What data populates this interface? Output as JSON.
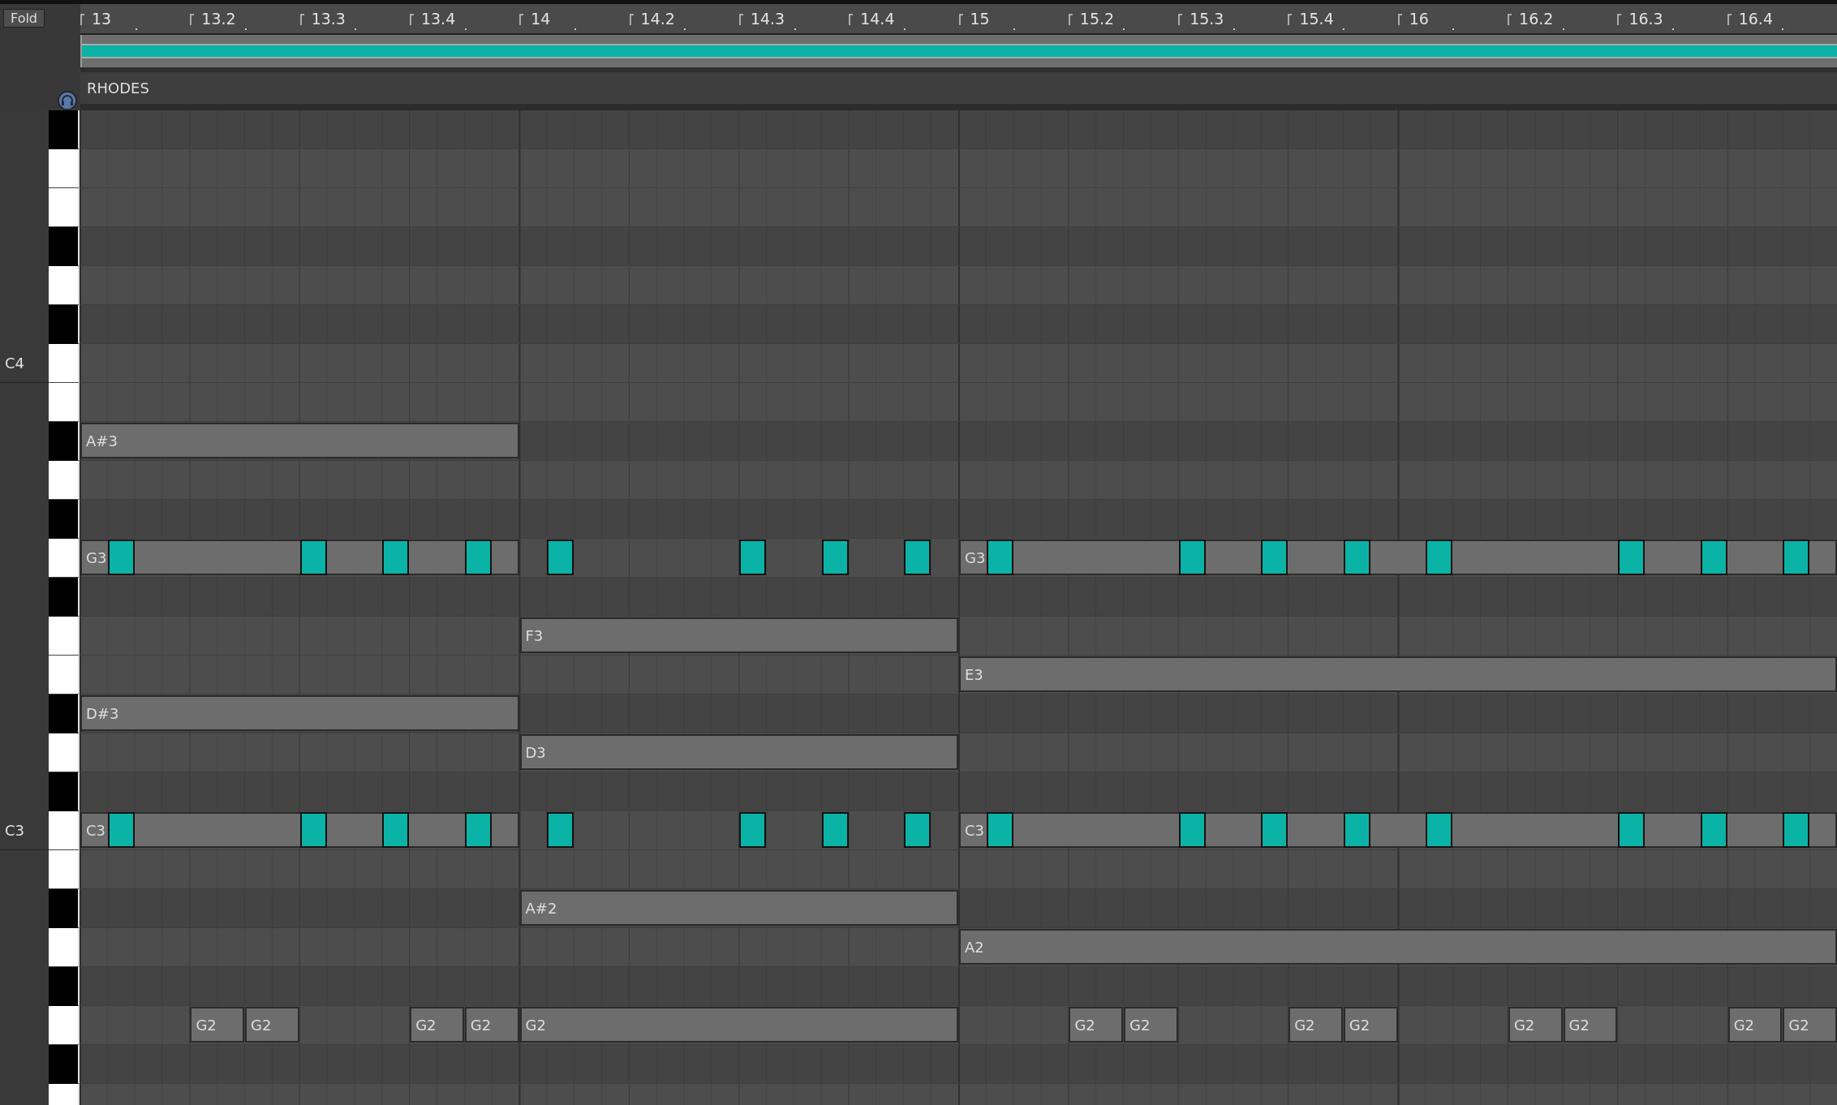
{
  "fold_button": "Fold",
  "ruler": [
    "13",
    "13.2",
    "13.3",
    "13.4",
    "14",
    "14.2",
    "14.3",
    "14.4",
    "15",
    "15.2",
    "15.3",
    "15.4",
    "16",
    "16.2",
    "16.3",
    "16.4"
  ],
  "clip": {
    "name": "RHODES"
  },
  "keys": [
    {
      "kind": "black"
    },
    {
      "kind": "white"
    },
    {
      "kind": "white"
    },
    {
      "kind": "black"
    },
    {
      "kind": "white"
    },
    {
      "kind": "black"
    },
    {
      "kind": "white",
      "octave_label": "C4"
    },
    {
      "kind": "white"
    },
    {
      "kind": "black",
      "notes": [
        {
          "kind": "bar",
          "rest": false,
          "label": "A#3",
          "selected": false
        }
      ]
    },
    {
      "kind": "white"
    },
    {
      "kind": "black"
    },
    {
      "kind": "white",
      "notes": [
        {
          "kind": "bar",
          "rest": false,
          "label": "G3",
          "selected": false
        },
        {
          "kind": "bar",
          "rest": true
        },
        {
          "kind": "two_bars",
          "rest": false,
          "label": "G3",
          "selected": false
        }
      ],
      "overlay": [
        {
          "kind": "sixteenth",
          "rest": true
        },
        {
          "kind": "sixteenth",
          "rest": false,
          "selected": true
        },
        {
          "kind": "dotted_quarter",
          "rest": true
        },
        {
          "kind": "sixteenth",
          "rest": false,
          "selected": true
        },
        {
          "kind": "eighth",
          "rest": true
        },
        {
          "kind": "sixteenth",
          "rest": false,
          "selected": true
        },
        {
          "kind": "eighth",
          "rest": true
        },
        {
          "kind": "sixteenth",
          "rest": false,
          "selected": true
        },
        {
          "kind": "sixteenth",
          "rest": true
        },
        {
          "kind": "sixteenth",
          "rest": true
        },
        {
          "kind": "sixteenth",
          "rest": false,
          "selected": true
        },
        {
          "kind": "dotted_quarter",
          "rest": true
        },
        {
          "kind": "sixteenth",
          "rest": false,
          "selected": true
        },
        {
          "kind": "eighth",
          "rest": true
        },
        {
          "kind": "sixteenth",
          "rest": false,
          "selected": true
        },
        {
          "kind": "eighth",
          "rest": true
        },
        {
          "kind": "sixteenth",
          "rest": false,
          "selected": true
        },
        {
          "kind": "sixteenth",
          "rest": true
        },
        {
          "kind": "sixteenth",
          "rest": true
        },
        {
          "kind": "sixteenth",
          "rest": false,
          "selected": true
        },
        {
          "kind": "dotted_quarter",
          "rest": true
        },
        {
          "kind": "sixteenth",
          "rest": false,
          "selected": true
        },
        {
          "kind": "eighth",
          "rest": true
        },
        {
          "kind": "sixteenth",
          "rest": false,
          "selected": true
        },
        {
          "kind": "eighth",
          "rest": true
        },
        {
          "kind": "sixteenth",
          "rest": false,
          "selected": true
        },
        {
          "kind": "sixteenth",
          "rest": true
        },
        {
          "kind": "sixteenth",
          "rest": true
        },
        {
          "kind": "sixteenth",
          "rest": false,
          "selected": true
        },
        {
          "kind": "dotted_quarter",
          "rest": true
        },
        {
          "kind": "sixteenth",
          "rest": false,
          "selected": true
        },
        {
          "kind": "eighth",
          "rest": true
        },
        {
          "kind": "sixteenth",
          "rest": false,
          "selected": true
        },
        {
          "kind": "eighth",
          "rest": true
        },
        {
          "kind": "sixteenth",
          "rest": false,
          "selected": true
        },
        {
          "kind": "sixteenth",
          "rest": true
        }
      ]
    },
    {
      "kind": "black"
    },
    {
      "kind": "white",
      "notes": [
        {
          "kind": "bar",
          "rest": true
        },
        {
          "kind": "bar",
          "rest": false,
          "label": "F3",
          "selected": false
        }
      ]
    },
    {
      "kind": "white",
      "notes": [
        {
          "kind": "two_bars",
          "rest": true
        },
        {
          "kind": "two_bars",
          "rest": false,
          "label": "E3",
          "selected": false
        }
      ]
    },
    {
      "kind": "black",
      "notes": [
        {
          "kind": "bar",
          "rest": false,
          "label": "D#3",
          "selected": false
        }
      ]
    },
    {
      "kind": "white",
      "notes": [
        {
          "kind": "bar",
          "rest": true
        },
        {
          "kind": "bar",
          "rest": false,
          "label": "D3",
          "selected": false
        }
      ]
    },
    {
      "kind": "black"
    },
    {
      "kind": "white",
      "octave_label": "C3",
      "notes": [
        {
          "kind": "bar",
          "rest": false,
          "label": "C3",
          "selected": false
        },
        {
          "kind": "bar",
          "rest": true
        },
        {
          "kind": "two_bars",
          "rest": false,
          "label": "C3",
          "selected": false
        }
      ],
      "overlay": [
        {
          "kind": "sixteenth",
          "rest": true
        },
        {
          "kind": "sixteenth",
          "rest": false,
          "selected": true
        },
        {
          "kind": "dotted_quarter",
          "rest": true
        },
        {
          "kind": "sixteenth",
          "rest": false,
          "selected": true
        },
        {
          "kind": "eighth",
          "rest": true
        },
        {
          "kind": "sixteenth",
          "rest": false,
          "selected": true
        },
        {
          "kind": "eighth",
          "rest": true
        },
        {
          "kind": "sixteenth",
          "rest": false,
          "selected": true
        },
        {
          "kind": "sixteenth",
          "rest": true
        },
        {
          "kind": "sixteenth",
          "rest": true
        },
        {
          "kind": "sixteenth",
          "rest": false,
          "selected": true
        },
        {
          "kind": "dotted_quarter",
          "rest": true
        },
        {
          "kind": "sixteenth",
          "rest": false,
          "selected": true
        },
        {
          "kind": "eighth",
          "rest": true
        },
        {
          "kind": "sixteenth",
          "rest": false,
          "selected": true
        },
        {
          "kind": "eighth",
          "rest": true
        },
        {
          "kind": "sixteenth",
          "rest": false,
          "selected": true
        },
        {
          "kind": "sixteenth",
          "rest": true
        },
        {
          "kind": "sixteenth",
          "rest": true
        },
        {
          "kind": "sixteenth",
          "rest": false,
          "selected": true
        },
        {
          "kind": "dotted_quarter",
          "rest": true
        },
        {
          "kind": "sixteenth",
          "rest": false,
          "selected": true
        },
        {
          "kind": "eighth",
          "rest": true
        },
        {
          "kind": "sixteenth",
          "rest": false,
          "selected": true
        },
        {
          "kind": "eighth",
          "rest": true
        },
        {
          "kind": "sixteenth",
          "rest": false,
          "selected": true
        },
        {
          "kind": "sixteenth",
          "rest": true
        },
        {
          "kind": "sixteenth",
          "rest": true
        },
        {
          "kind": "sixteenth",
          "rest": false,
          "selected": true
        },
        {
          "kind": "dotted_quarter",
          "rest": true
        },
        {
          "kind": "sixteenth",
          "rest": false,
          "selected": true
        },
        {
          "kind": "eighth",
          "rest": true
        },
        {
          "kind": "sixteenth",
          "rest": false,
          "selected": true
        },
        {
          "kind": "eighth",
          "rest": true
        },
        {
          "kind": "sixteenth",
          "rest": false,
          "selected": true
        },
        {
          "kind": "sixteenth",
          "rest": true
        }
      ]
    },
    {
      "kind": "white"
    },
    {
      "kind": "black",
      "notes": [
        {
          "kind": "bar",
          "rest": true
        },
        {
          "kind": "bar",
          "rest": false,
          "label": "A#2",
          "selected": false
        }
      ]
    },
    {
      "kind": "white",
      "notes": [
        {
          "kind": "two_bars",
          "rest": true
        },
        {
          "kind": "two_bars",
          "rest": false,
          "label": "A2",
          "selected": false
        }
      ]
    },
    {
      "kind": "black"
    },
    {
      "kind": "white",
      "notes": [
        {
          "kind": "quarter",
          "rest": true
        },
        {
          "kind": "eighth",
          "rest": false,
          "label": "G2",
          "selected": false
        },
        {
          "kind": "eighth",
          "rest": false,
          "label": "G2",
          "selected": false
        },
        {
          "kind": "quarter",
          "rest": true
        },
        {
          "kind": "eighth",
          "rest": false,
          "label": "G2",
          "selected": false
        },
        {
          "kind": "eighth",
          "rest": false,
          "label": "G2",
          "selected": false
        },
        {
          "kind": "bar",
          "rest": false,
          "label": "G2",
          "selected": false
        },
        {
          "kind": "quarter",
          "rest": true
        },
        {
          "kind": "eighth",
          "rest": false,
          "label": "G2",
          "selected": false
        },
        {
          "kind": "eighth",
          "rest": false,
          "label": "G2",
          "selected": false
        },
        {
          "kind": "quarter",
          "rest": true
        },
        {
          "kind": "eighth",
          "rest": false,
          "label": "G2",
          "selected": false
        },
        {
          "kind": "eighth",
          "rest": false,
          "label": "G2",
          "selected": false
        },
        {
          "kind": "quarter",
          "rest": true
        },
        {
          "kind": "eighth",
          "rest": false,
          "label": "G2",
          "selected": false
        },
        {
          "kind": "eighth",
          "rest": false,
          "label": "G2",
          "selected": false
        },
        {
          "kind": "quarter",
          "rest": true
        },
        {
          "kind": "eighth",
          "rest": false,
          "label": "G2",
          "selected": false
        },
        {
          "kind": "eighth",
          "rest": false,
          "label": "G2",
          "selected": false
        }
      ]
    },
    {
      "kind": "black"
    },
    {
      "kind": "white"
    }
  ]
}
